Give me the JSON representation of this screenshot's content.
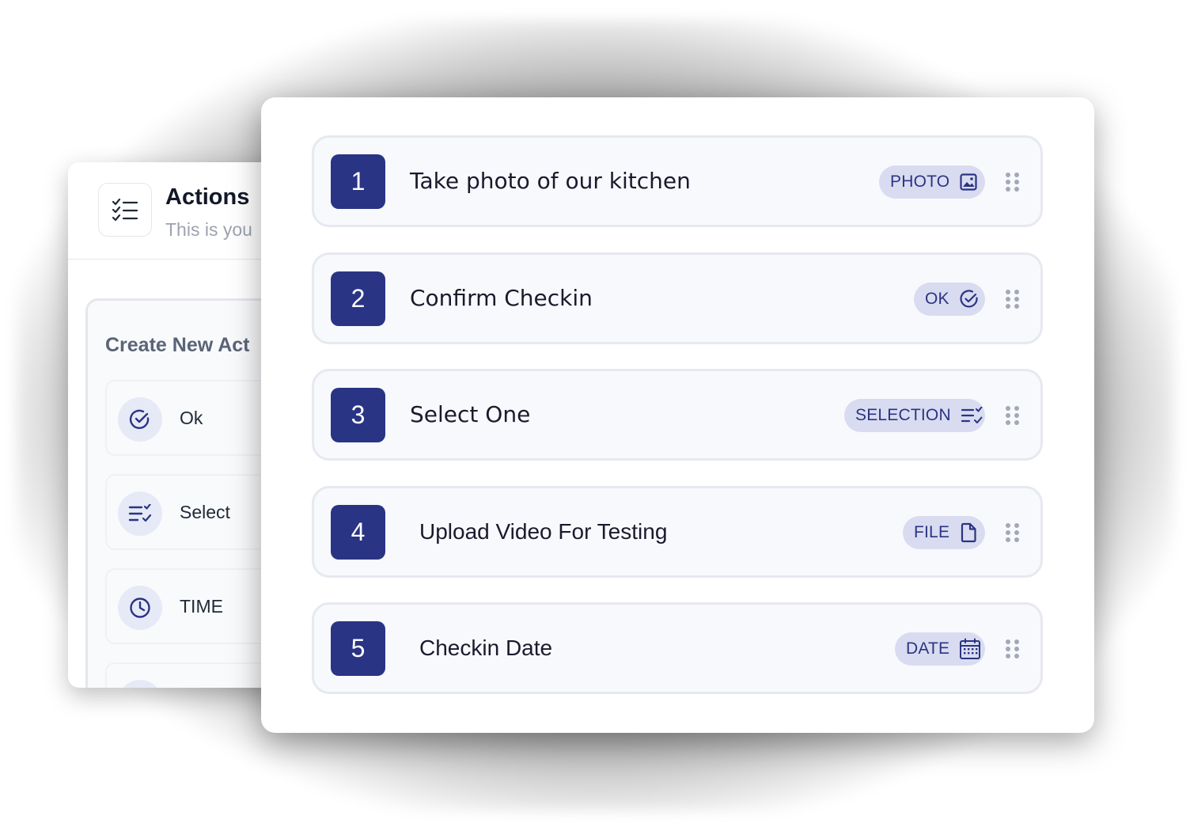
{
  "back_panel": {
    "title": "Actions",
    "subtitle": "This is you",
    "header_icon": "checklist-icon",
    "create_section": {
      "title": "Create New Act",
      "types": [
        {
          "label": "Ok",
          "icon": "check-circle-icon"
        },
        {
          "label": "Select",
          "icon": "list-check-icon"
        },
        {
          "label": "TIME",
          "icon": "clock-icon"
        }
      ]
    }
  },
  "tasks": [
    {
      "number": "1",
      "label": "Take photo of our kitchen",
      "tag": "PHOTO",
      "tag_icon": "image-icon"
    },
    {
      "number": "2",
      "label": "Confirm Checkin",
      "tag": "OK",
      "tag_icon": "check-circle-icon"
    },
    {
      "number": "3",
      "label": "Select One",
      "tag": "SELECTION",
      "tag_icon": "list-check-icon"
    },
    {
      "number": "4",
      "label": "Upload Video For Testing",
      "tag": "FILE",
      "tag_icon": "file-icon"
    },
    {
      "number": "5",
      "label": "Checkin Date",
      "tag": "DATE",
      "tag_icon": "calendar-icon"
    }
  ],
  "colors": {
    "accent": "#2a3484",
    "tag_bg": "#d9dcf0",
    "row_bg": "#f8f9fc",
    "icon_circle_bg": "#e6eaf7"
  }
}
